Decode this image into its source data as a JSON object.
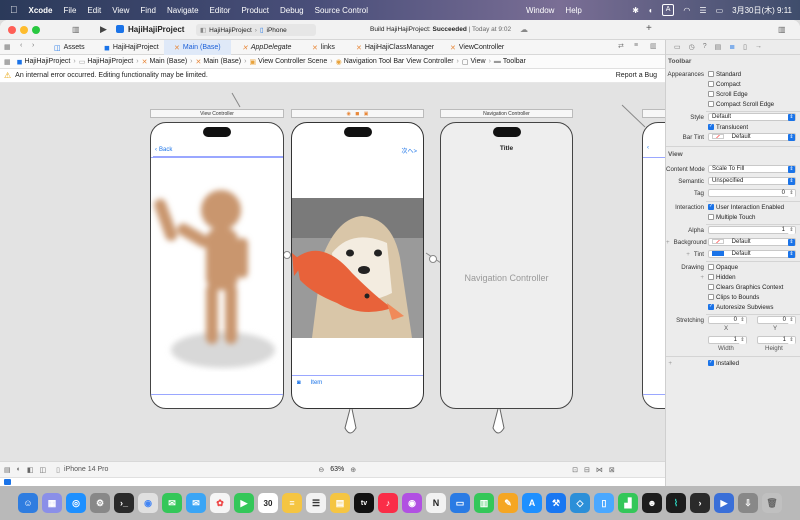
{
  "menubar": {
    "app": "Xcode",
    "items": [
      "File",
      "Edit",
      "View",
      "Find",
      "Navigate",
      "Editor",
      "Product",
      "Debug",
      "Source Control",
      "Window",
      "Help"
    ],
    "input_mode": "A",
    "clock": "3月30日(木) 9:11"
  },
  "toolbar": {
    "project": "HajiHajiProject",
    "scheme": "HajiHajiProject",
    "device": "iPhone",
    "build_prefix": "Build HajiHajiProject:",
    "build_status": "Succeeded",
    "build_time": "| Today at 9:02"
  },
  "tabs": [
    "Assets",
    "HajiHajiProject",
    "Main (Base)",
    "AppDelegate",
    "links",
    "HajiHajiClassManager",
    "ViewController"
  ],
  "jumpbar": [
    "HajiHajiProject",
    "HajiHajiProject",
    "Main (Base)",
    "Main (Base)",
    "View Controller Scene",
    "Navigation Tool Bar View Controller",
    "View",
    "Toolbar"
  ],
  "error": {
    "message": "An internal error occurred. Editing functionality may be limited.",
    "action": "Report a Bug"
  },
  "scenes": {
    "vc_title": "View Controller",
    "nav_title": "Navigation Controller",
    "back_label": "Back",
    "next_label": "次へ>",
    "nav_item_title": "Title",
    "nav_placeholder": "Navigation Controller",
    "toolbar_item": "Item"
  },
  "bottombar": {
    "device": "iPhone 14 Pro",
    "zoom": "63%"
  },
  "inspector": {
    "toolbar_section": "Toolbar",
    "appearances_label": "Appearances",
    "appearances": [
      {
        "label": "Standard",
        "checked": false
      },
      {
        "label": "Compact",
        "checked": false
      },
      {
        "label": "Scroll Edge",
        "checked": false
      },
      {
        "label": "Compact Scroll Edge",
        "checked": false
      }
    ],
    "style_label": "Style",
    "style_value": "Default",
    "translucent_label": "Translucent",
    "bar_tint_label": "Bar Tint",
    "bar_tint_value": "Default",
    "view_section": "View",
    "content_mode_label": "Content Mode",
    "content_mode_value": "Scale To Fill",
    "semantic_label": "Semantic",
    "semantic_value": "Unspecified",
    "tag_label": "Tag",
    "tag_value": "0",
    "interaction_label": "Interaction",
    "user_interaction": "User Interaction Enabled",
    "multiple_touch": "Multiple Touch",
    "alpha_label": "Alpha",
    "alpha_value": "1",
    "background_label": "Background",
    "background_value": "Default",
    "tint_label": "Tint",
    "tint_value": "Default",
    "drawing_label": "Drawing",
    "opaque": "Opaque",
    "hidden": "Hidden",
    "clears": "Clears Graphics Context",
    "clips": "Clips to Bounds",
    "autoresize": "Autoresize Subviews",
    "stretching_label": "Stretching",
    "stretch_x": "0",
    "stretch_y": "0",
    "x_label": "X",
    "y_label": "Y",
    "stretch_w": "1",
    "stretch_h": "1",
    "width_label": "Width",
    "height_label": "Height",
    "installed": "Installed",
    "accent_color": "#1a73e8"
  },
  "dock": {
    "calendar_day": "30",
    "appletv": "tv"
  }
}
